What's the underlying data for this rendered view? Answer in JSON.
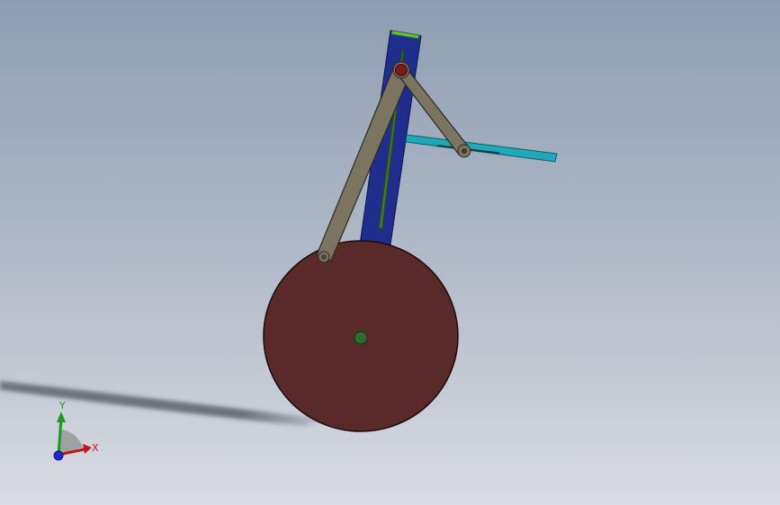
{
  "viewport": {
    "background_top": "#8e9db3",
    "background_bottom": "#d9dce2"
  },
  "model": {
    "wheel_color": "#5a2a2b",
    "wheel_hub_color": "#2e6b2e",
    "long_link_color": "#7b7460",
    "short_link_color": "#7b7460",
    "guide_bar_color": "#1f2d8c",
    "guide_slot_color": "#3f7a3a",
    "guide_cap_color": "#5fbf4a",
    "slider_rod_color": "#1fa8b8",
    "top_pin_color": "#7a1a1a"
  },
  "triad": {
    "x_label": "X",
    "y_label": "Y",
    "x_color": "#c0141e",
    "y_color": "#1d9a1d",
    "z_color": "#1a2bd0"
  }
}
